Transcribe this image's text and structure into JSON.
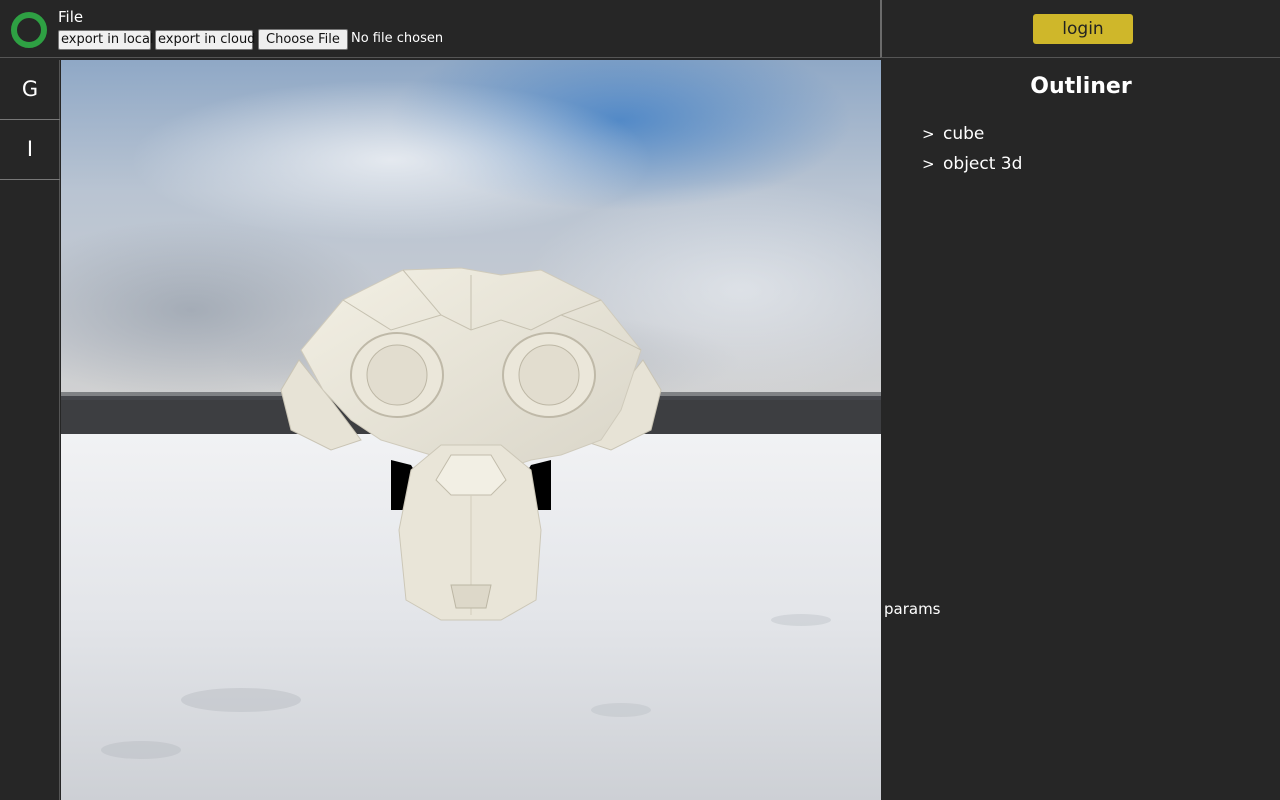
{
  "header": {
    "file_menu_label": "File",
    "export_local_label": "export in local",
    "export_cloud_label": "export in cloud",
    "choose_file_label": "Choose File",
    "file_status_text": "No file chosen",
    "login_label": "login"
  },
  "toolbar": {
    "items": [
      {
        "label": "G"
      },
      {
        "label": "I"
      }
    ]
  },
  "outliner": {
    "title": "Outliner",
    "expand_glyph": ">",
    "items": [
      {
        "label": "cube"
      },
      {
        "label": "object 3d"
      }
    ]
  },
  "params": {
    "label": "params"
  },
  "colors": {
    "background": "#262626",
    "accent_login": "#cfb72a",
    "logo_ring": "#2ea043",
    "mesh_color": "#e8e4d8"
  }
}
